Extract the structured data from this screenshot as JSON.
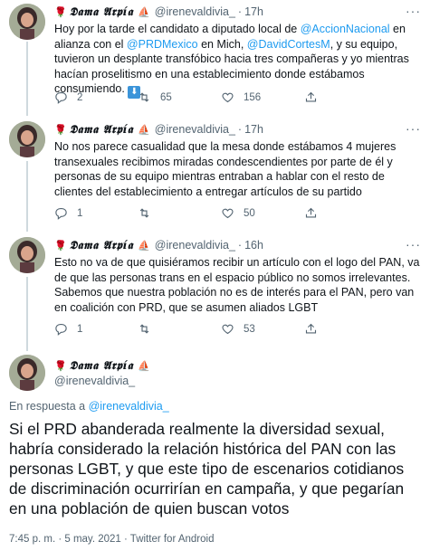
{
  "author": {
    "display_name": "𝕯𝖆𝖒𝖆 𝕬𝖗𝖕í𝖆",
    "handle": "@irenevaldivia_",
    "rose": "🌹",
    "ship": "⛵"
  },
  "tweets": [
    {
      "dot": "·",
      "time": "17h",
      "text_parts": [
        "Hoy por la tarde el candidato a diputado local de ",
        "@AccionNacional",
        " en alianza con el ",
        "@PRDMexico",
        " en Mich, ",
        "@DavidCortesM",
        ", y su equipo, tuvieron un desplante transfóbico hacia tres compañeras y yo mientras hacían proselitismo en una establecimiento donde estábamos consumiendo. "
      ],
      "arrow": "⬇",
      "replies": "2",
      "retweets": "65",
      "likes": "156"
    },
    {
      "dot": "·",
      "time": "17h",
      "text": "No nos parece casualidad que la mesa donde estábamos 4 mujeres transexuales recibimos miradas condescendientes por parte de él y personas de su equipo mientras entraban a hablar con el resto de clientes del establecimiento a entregar artículos de su partido",
      "replies": "1",
      "retweets": "",
      "likes": "50"
    },
    {
      "dot": "·",
      "time": "16h",
      "text": "Esto no va de que quisiéramos recibir un artículo con el logo del PAN, va de que las personas trans en el espacio público no somos irrelevantes. Sabemos que nuestra población no es de interés para el PAN, pero van en coalición con PRD, que se asumen aliados LGBT",
      "replies": "1",
      "retweets": "",
      "likes": "53"
    }
  ],
  "main_tweet": {
    "reply_prefix": "En respuesta a ",
    "reply_to": "@irenevaldivia_",
    "text": "Si el PRD abanderada realmente la diversidad sexual, habría considerado la relación histórica del PAN con las personas LGBT, y que este tipo de escenarios cotidianos de discriminación ocurrirían en campaña, y que pegarían en una población de quien buscan votos",
    "timestamp": "7:45 p. m. · 5 may. 2021 · Twitter for Android"
  },
  "more_icon": "···",
  "colors": {
    "link": "#1d9bf0",
    "muted": "#536471",
    "thread_line": "#cfd9de"
  }
}
